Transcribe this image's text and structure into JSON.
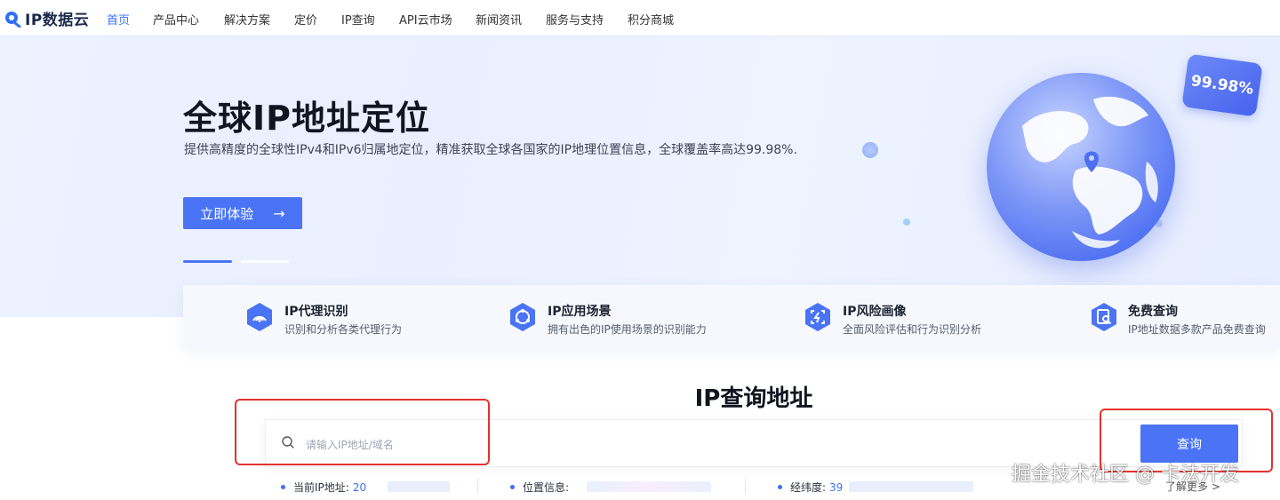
{
  "brand": {
    "name": "IP数据云"
  },
  "nav": {
    "items": [
      "首页",
      "产品中心",
      "解决方案",
      "定价",
      "IP查询",
      "API云市场",
      "新闻资讯",
      "服务与支持",
      "积分商城"
    ],
    "active_index": 0
  },
  "hero": {
    "title": "全球IP地址定位",
    "subtitle": "提供高精度的全球性IPv4和IPv6归属地定位，精准获取全球各国家的IP地理位置信息，全球覆盖率高达99.98%.",
    "cta_label": "立即体验",
    "cta_arrow": "→",
    "badge": "99.98%",
    "slides": 2,
    "active_slide": 0
  },
  "features": [
    {
      "icon": "signal-icon",
      "title": "IP代理识别",
      "desc": "识别和分析各类代理行为"
    },
    {
      "icon": "ring-icon",
      "title": "IP应用场景",
      "desc": "拥有出色的IP使用场景的识别能力"
    },
    {
      "icon": "scan-icon",
      "title": "IP风险画像",
      "desc": "全面风险评估和行为识别分析"
    },
    {
      "icon": "magnify-doc-icon",
      "title": "免费查询",
      "desc": "IP地址数据多款产品免费查询"
    }
  ],
  "query": {
    "title": "IP查询地址",
    "placeholder": "请输入IP地址/域名",
    "value": "",
    "button_label": "查询"
  },
  "info": {
    "current_ip_label": "当前IP地址:",
    "current_ip_value": "20",
    "location_label": "位置信息:",
    "location_value": "",
    "coords_label": "经纬度:",
    "coords_value": "39",
    "more_label": "了解更多",
    "more_arrow": ">"
  },
  "watermark": "掘金技术社区 @ 卡法开发",
  "colors": {
    "accent": "#4a74f5",
    "highlight": "#e5322d",
    "hero_bg": "#e9efff"
  }
}
